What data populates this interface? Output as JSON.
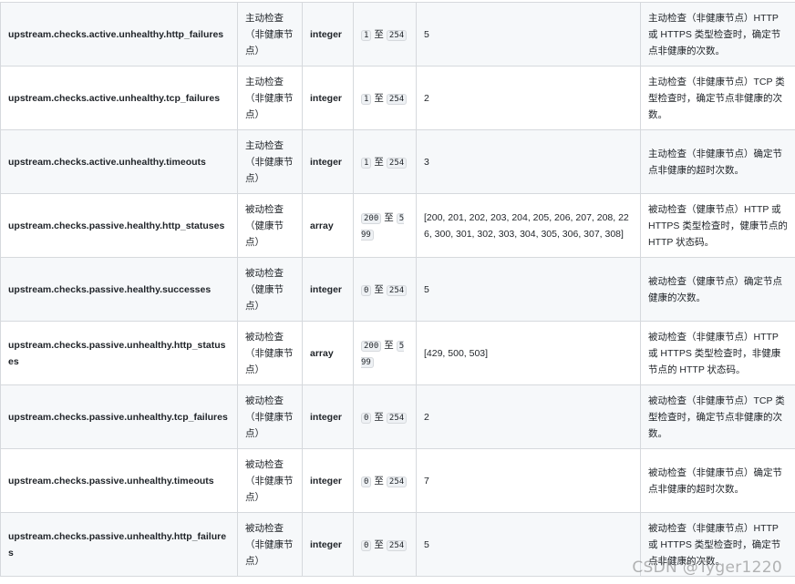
{
  "rows": [
    {
      "name": "upstream.checks.active.unhealthy.http_failures",
      "category": "主动检查（非健康节点）",
      "type": "integer",
      "range_min": "1",
      "range_sep": "至",
      "range_max": "254",
      "default": "5",
      "description": "主动检查（非健康节点）HTTP 或 HTTPS 类型检查时，确定节点非健康的次数。"
    },
    {
      "name": "upstream.checks.active.unhealthy.tcp_failures",
      "category": "主动检查（非健康节点）",
      "type": "integer",
      "range_min": "1",
      "range_sep": "至",
      "range_max": "254",
      "default": "2",
      "description": "主动检查（非健康节点）TCP 类型检查时，确定节点非健康的次数。"
    },
    {
      "name": "upstream.checks.active.unhealthy.timeouts",
      "category": "主动检查（非健康节点）",
      "type": "integer",
      "range_min": "1",
      "range_sep": "至",
      "range_max": "254",
      "default": "3",
      "description": "主动检查（非健康节点）确定节点非健康的超时次数。"
    },
    {
      "name": "upstream.checks.passive.healthy.http_statuses",
      "category": "被动检查（健康节点）",
      "type": "array",
      "range_min": "200",
      "range_sep": "至",
      "range_max": "599",
      "default": "[200, 201, 202, 203, 204, 205, 206, 207, 208, 226, 300, 301, 302, 303, 304, 305, 306, 307, 308]",
      "description": "被动检查（健康节点）HTTP 或 HTTPS 类型检查时，健康节点的 HTTP 状态码。"
    },
    {
      "name": "upstream.checks.passive.healthy.successes",
      "category": "被动检查（健康节点）",
      "type": "integer",
      "range_min": "0",
      "range_sep": "至",
      "range_max": "254",
      "default": "5",
      "description": "被动检查（健康节点）确定节点健康的次数。"
    },
    {
      "name": "upstream.checks.passive.unhealthy.http_statuses",
      "category": "被动检查（非健康节点）",
      "type": "array",
      "range_min": "200",
      "range_sep": "至",
      "range_max": "599",
      "default": "[429, 500, 503]",
      "description": "被动检查（非健康节点）HTTP 或 HTTPS 类型检查时，非健康节点的 HTTP 状态码。"
    },
    {
      "name": "upstream.checks.passive.unhealthy.tcp_failures",
      "category": "被动检查（非健康节点）",
      "type": "integer",
      "range_min": "0",
      "range_sep": "至",
      "range_max": "254",
      "default": "2",
      "description": "被动检查（非健康节点）TCP 类型检查时，确定节点非健康的次数。"
    },
    {
      "name": "upstream.checks.passive.unhealthy.timeouts",
      "category": "被动检查（非健康节点）",
      "type": "integer",
      "range_min": "0",
      "range_sep": "至",
      "range_max": "254",
      "default": "7",
      "description": "被动检查（非健康节点）确定节点非健康的超时次数。"
    },
    {
      "name": "upstream.checks.passive.unhealthy.http_failures",
      "category": "被动检查（非健康节点）",
      "type": "integer",
      "range_min": "0",
      "range_sep": "至",
      "range_max": "254",
      "default": "5",
      "description": "被动检查（非健康节点）HTTP 或 HTTPS 类型检查时，确定节点非健康的次数。"
    }
  ],
  "watermark": "CSDN @Tyger1220"
}
